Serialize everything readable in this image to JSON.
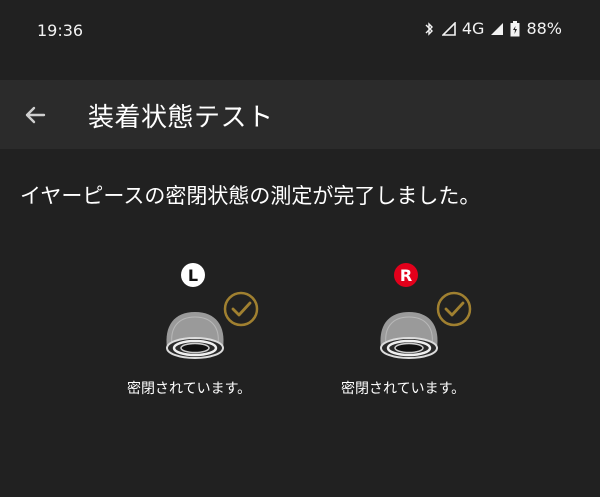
{
  "status_bar": {
    "time": "19:36",
    "network": "4G",
    "battery": "88%"
  },
  "app_bar": {
    "title": "装着状態テスト"
  },
  "message": "イヤーピースの密閉状態の測定が完了しました。",
  "earbuds": [
    {
      "side": "L",
      "status": "密閉されています。",
      "badge_bg": "#ffffff",
      "badge_fg": "#111111"
    },
    {
      "side": "R",
      "status": "密閉されています。",
      "badge_bg": "#e3001b",
      "badge_fg": "#ffffff"
    }
  ],
  "colors": {
    "background": "#212121",
    "app_bar": "#2b2b2b",
    "check": "#a08030"
  }
}
